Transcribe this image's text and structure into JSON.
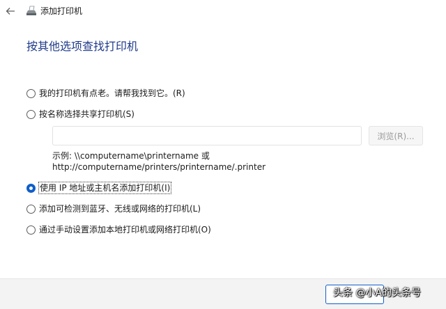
{
  "window": {
    "title": "添加打印机",
    "icon": "printer-icon"
  },
  "heading": "按其他选项查找打印机",
  "options": [
    {
      "label": "我的打印机有点老。请帮我找到它。(R)",
      "checked": false
    },
    {
      "label": "按名称选择共享打印机(S)",
      "checked": false
    },
    {
      "label": "使用 IP 地址或主机名添加打印机(I)",
      "checked": true
    },
    {
      "label": "添加可检测到蓝牙、无线或网络的打印机(L)",
      "checked": false
    },
    {
      "label": "通过手动设置添加本地打印机或网络打印机(O)",
      "checked": false
    }
  ],
  "shared_printer": {
    "value": "",
    "browse_label": "浏览(R)...",
    "example_line1": "示例: \\\\computername\\printername 或",
    "example_line2": "http://computername/printers/printername/.printer"
  },
  "watermark": "头条 @小A的头条号",
  "colors": {
    "accent": "#0f5ec9",
    "heading": "#1f3a8a"
  }
}
